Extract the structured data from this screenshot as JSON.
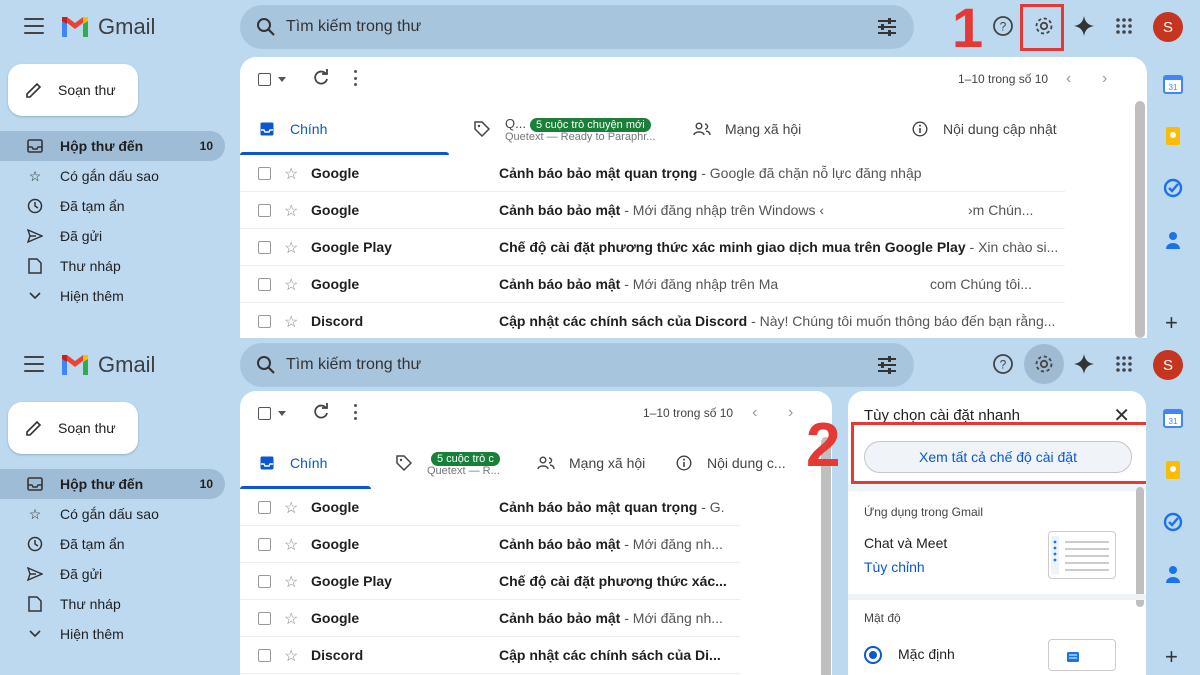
{
  "app": {
    "name": "Gmail"
  },
  "header": {
    "search_placeholder": "Tìm kiếm trong thư",
    "avatar_letter": "S"
  },
  "annotations": {
    "step1": "1",
    "step2": "2"
  },
  "sidebar": {
    "compose_label": "Soạn thư",
    "items": [
      {
        "label": "Hộp thư đến",
        "count": "10",
        "icon": "inbox-icon"
      },
      {
        "label": "Có gắn dấu sao",
        "icon": "star-icon"
      },
      {
        "label": "Đã tạm ẩn",
        "icon": "clock-icon"
      },
      {
        "label": "Đã gửi",
        "icon": "send-icon"
      },
      {
        "label": "Thư nháp",
        "icon": "draft-icon"
      },
      {
        "label": "Hiện thêm",
        "icon": "chevron-down-icon"
      }
    ]
  },
  "toolbar": {
    "pager_text": "1–10 trong số 10"
  },
  "tabs": {
    "primary": "Chính",
    "promo_short_top": "Q...",
    "promo_badge_top": "5 cuộc trò chuyện mới",
    "promo_sub_top": "Quetext — Ready to Paraphr...",
    "promo_badge_bottom": "5 cuộc trò c",
    "promo_sub_bottom": "Quetext — R...",
    "social": "Mạng xã hội",
    "updates_top": "Nội dung cập nhật",
    "updates_bottom": "Nội dung c..."
  },
  "emails_top": [
    {
      "sender": "Google",
      "subject": "Cảnh báo bảo mật quan trọng",
      "snippet": " - Google đã chặn nỗ lực đăng nhập",
      "tail": ""
    },
    {
      "sender": "Google",
      "subject": "Cảnh báo bảo mật",
      "snippet": " - Mới đăng nhập trên Windows ‹",
      "tail": "›m Chún..."
    },
    {
      "sender": "Google Play",
      "subject": "Chế độ cài đặt phương thức xác minh giao dịch mua trên Google Play",
      "snippet": " - Xin chào si...",
      "tail": ""
    },
    {
      "sender": "Google",
      "subject": "Cảnh báo bảo mật",
      "snippet": " - Mới đăng nhập trên Ma",
      "tail": "com Chúng tôi..."
    },
    {
      "sender": "Discord",
      "subject": "Cập nhật các chính sách của Discord",
      "snippet": " - Này! Chúng tôi muốn thông báo đến bạn rằng...",
      "tail": ""
    }
  ],
  "emails_bottom": [
    {
      "sender": "Google",
      "subject": "Cảnh báo bảo mật quan trọng",
      "snippet": " - G."
    },
    {
      "sender": "Google",
      "subject": "Cảnh báo bảo mật",
      "snippet": " - Mới đăng nh..."
    },
    {
      "sender": "Google Play",
      "subject": "Chế độ cài đặt phương thức xác...",
      "snippet": ""
    },
    {
      "sender": "Google",
      "subject": "Cảnh báo bảo mật",
      "snippet": " - Mới đăng nh..."
    },
    {
      "sender": "Discord",
      "subject": "Cập nhật các chính sách của Di...",
      "snippet": ""
    }
  ],
  "quick_settings": {
    "title": "Tùy chọn cài đặt nhanh",
    "see_all_button": "Xem tất cả chế độ cài đặt",
    "apps_section": "Ứng dụng trong Gmail",
    "chat_meet": "Chat và Meet",
    "customize_link": "Tùy chỉnh",
    "density_section": "Mật độ",
    "density_default": "Mặc định"
  },
  "rail": {
    "calendar_day": "31"
  }
}
